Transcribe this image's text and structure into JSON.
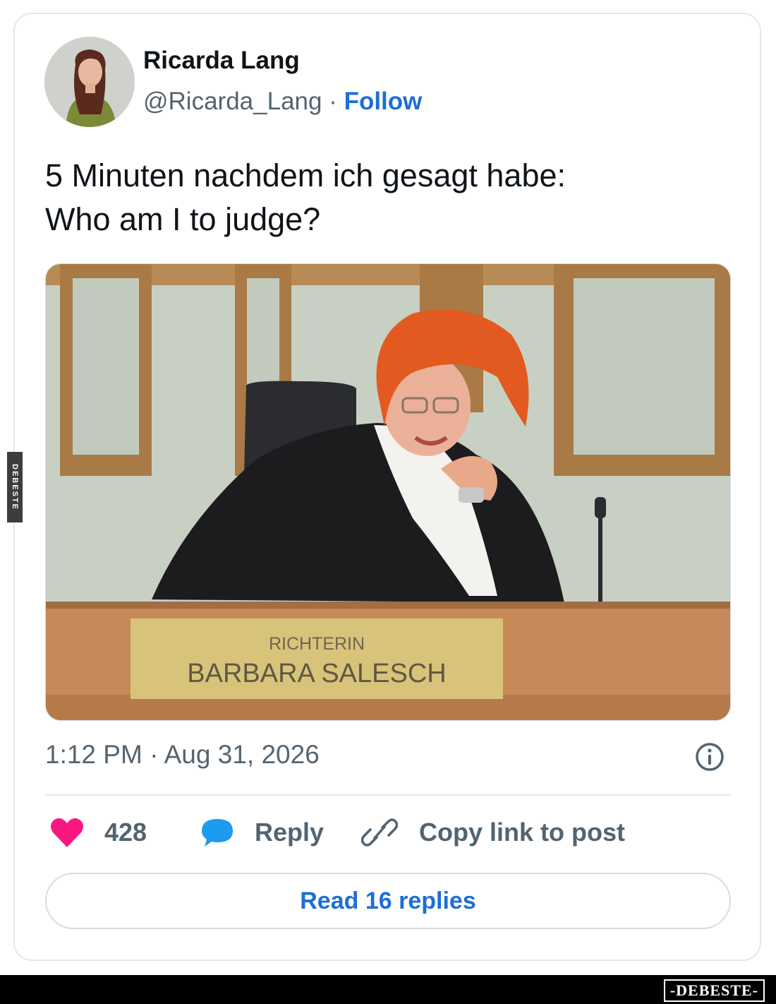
{
  "author": {
    "name": "Ricarda Lang",
    "handle": "@Ricarda_Lang",
    "separator": " · ",
    "follow_label": "Follow"
  },
  "tweet": {
    "text_lines": [
      "5 Minuten nachdem ich gesagt habe:",
      "Who am I to judge?"
    ],
    "image": {
      "nameplate_line1": "RICHTERIN",
      "nameplate_line2": "BARBARA SALESCH"
    },
    "timestamp": "1:12 PM · Aug 31, 2026"
  },
  "actions": {
    "like_count": "428",
    "reply_label": "Reply",
    "copy_link_label": "Copy link to post"
  },
  "read_replies_label": "Read 16 replies",
  "watermarks": {
    "side": "DEBESTE",
    "bottom": "-DEBESTE-"
  },
  "colors": {
    "accent": "#1d6fd6",
    "like": "#f91880",
    "reply_bubble": "#1d9bf0",
    "muted": "#536471"
  }
}
